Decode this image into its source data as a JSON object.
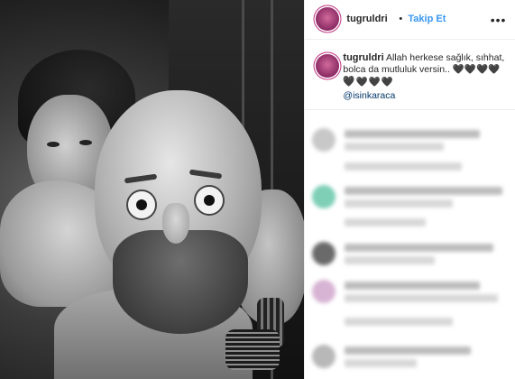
{
  "post": {
    "username": "tugruldri",
    "separator": "•",
    "follow_label": "Takip Et",
    "more_label": "•••",
    "caption_user": "tugruldri",
    "caption_text": "Allah herkese sağlık, sıhhat, bolca da mutluluk versin.. 🖤🖤🖤🖤🖤",
    "caption_hearts": "🖤🖤🖤🖤",
    "mention": "@isinkaraca"
  },
  "colors": {
    "link_blue": "#3897f0",
    "mention_blue": "#003569",
    "text_dark": "#262626",
    "border": "#efefef"
  },
  "icons": {
    "avatar": "profile-picture",
    "more": "more-options-icon"
  }
}
